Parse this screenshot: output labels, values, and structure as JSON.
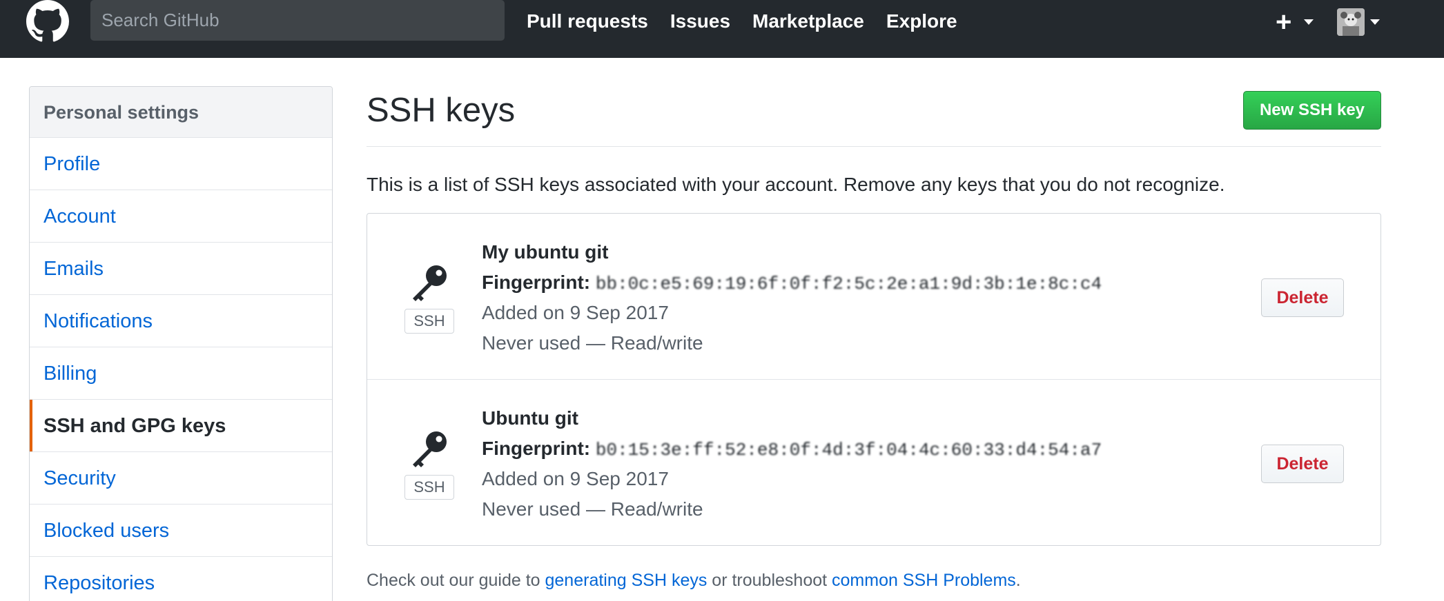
{
  "header": {
    "search_placeholder": "Search GitHub",
    "nav": [
      "Pull requests",
      "Issues",
      "Marketplace",
      "Explore"
    ],
    "plus_label": "+"
  },
  "sidebar": {
    "heading": "Personal settings",
    "items": [
      {
        "label": "Profile",
        "selected": false
      },
      {
        "label": "Account",
        "selected": false
      },
      {
        "label": "Emails",
        "selected": false
      },
      {
        "label": "Notifications",
        "selected": false
      },
      {
        "label": "Billing",
        "selected": false
      },
      {
        "label": "SSH and GPG keys",
        "selected": true
      },
      {
        "label": "Security",
        "selected": false
      },
      {
        "label": "Blocked users",
        "selected": false
      },
      {
        "label": "Repositories",
        "selected": false
      }
    ]
  },
  "main": {
    "title": "SSH keys",
    "new_key_button": "New SSH key",
    "intro": "This is a list of SSH keys associated with your account. Remove any keys that you do not recognize.",
    "keys": [
      {
        "title": "My ubuntu git",
        "fingerprint_label": "Fingerprint:",
        "fingerprint": "bb:0c:e5:69:19:6f:0f:f2:5c:2e:a1:9d:3b:1e:8c:c4",
        "added": "Added on 9 Sep 2017",
        "usage": "Never used — Read/write",
        "badge": "SSH",
        "delete_label": "Delete"
      },
      {
        "title": "Ubuntu git",
        "fingerprint_label": "Fingerprint:",
        "fingerprint": "b0:15:3e:ff:52:e8:0f:4d:3f:04:4c:60:33:d4:54:a7",
        "added": "Added on 9 Sep 2017",
        "usage": "Never used — Read/write",
        "badge": "SSH",
        "delete_label": "Delete"
      }
    ],
    "footer": {
      "prefix": "Check out our guide to ",
      "link1": "generating SSH keys",
      "middle": " or troubleshoot ",
      "link2": "common SSH Problems",
      "suffix": "."
    }
  },
  "colors": {
    "header_bg": "#24292e",
    "link": "#0366d6",
    "green_button": "#28a745",
    "danger": "#cb2431",
    "selected_marker": "#e36209"
  },
  "icons": [
    "github-mark-icon",
    "plus-icon",
    "caret-down-icon",
    "avatar",
    "key-icon"
  ]
}
